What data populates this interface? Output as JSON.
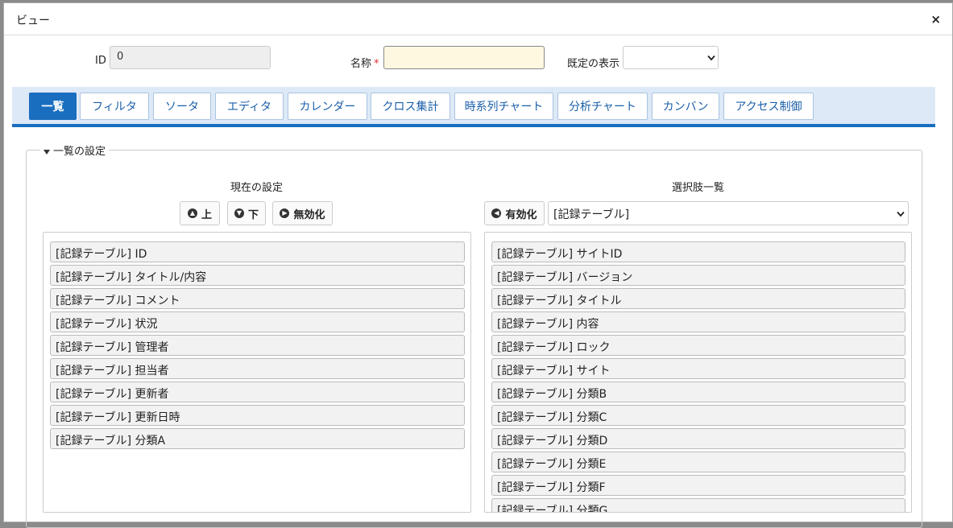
{
  "dialog": {
    "title": "ビュー",
    "close_glyph": "×"
  },
  "form": {
    "id_label": "ID",
    "id_value": "0",
    "name_label": "名称",
    "required_mark": "*",
    "name_value": "",
    "default_label": "既定の表示",
    "default_value": ""
  },
  "tabs": [
    {
      "label": "一覧",
      "active": true
    },
    {
      "label": "フィルタ"
    },
    {
      "label": "ソータ"
    },
    {
      "label": "エディタ"
    },
    {
      "label": "カレンダー"
    },
    {
      "label": "クロス集計"
    },
    {
      "label": "時系列チャート"
    },
    {
      "label": "分析チャート"
    },
    {
      "label": "カンバン"
    },
    {
      "label": "アクセス制御"
    }
  ],
  "section": {
    "legend": "一覧の設定"
  },
  "current": {
    "heading": "現在の設定",
    "up_label": "上",
    "down_label": "下",
    "disable_label": "無効化",
    "items": [
      "[記録テーブル] ID",
      "[記録テーブル] タイトル/内容",
      "[記録テーブル] コメント",
      "[記録テーブル] 状況",
      "[記録テーブル] 管理者",
      "[記録テーブル] 担当者",
      "[記録テーブル] 更新者",
      "[記録テーブル] 更新日時",
      "[記録テーブル] 分類A"
    ]
  },
  "options": {
    "heading": "選択肢一覧",
    "enable_label": "有効化",
    "source_value": "[記録テーブル]",
    "items": [
      "[記録テーブル] サイトID",
      "[記録テーブル] バージョン",
      "[記録テーブル] タイトル",
      "[記録テーブル] 内容",
      "[記録テーブル] ロック",
      "[記録テーブル] サイト",
      "[記録テーブル] 分類B",
      "[記録テーブル] 分類C",
      "[記録テーブル] 分類D",
      "[記録テーブル] 分類E",
      "[記録テーブル] 分類F",
      "[記録テーブル] 分類G"
    ]
  },
  "colors": {
    "accent": "#1a6ebf",
    "tabbar_bg": "#dde9f7",
    "name_input_bg": "#fff8e1",
    "required": "#dd3333"
  }
}
